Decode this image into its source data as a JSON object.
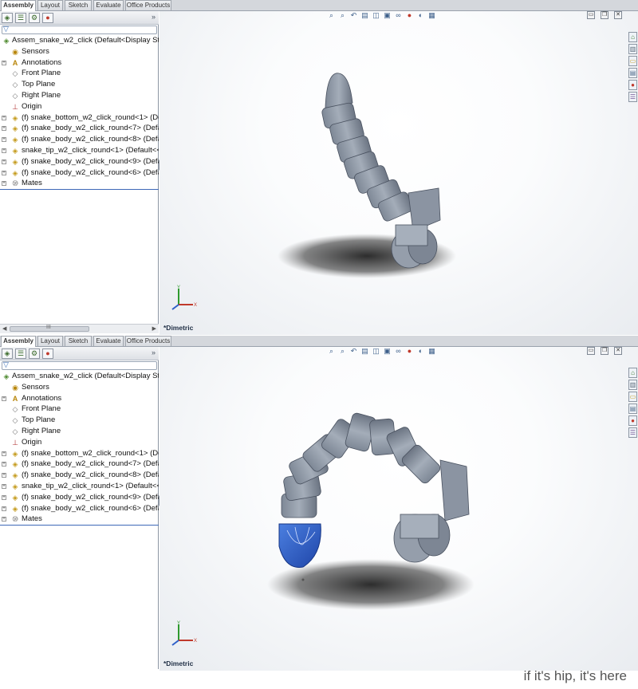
{
  "tabs": [
    "Assembly",
    "Layout",
    "Sketch",
    "Evaluate",
    "Office Products"
  ],
  "tree": {
    "root": "Assem_snake_w2_click  (Default<Display Sta",
    "items": [
      {
        "label": "Sensors",
        "icon": "sensor-icon",
        "expandable": false
      },
      {
        "label": "Annotations",
        "icon": "annotations-icon",
        "expandable": true
      },
      {
        "label": "Front Plane",
        "icon": "plane-icon",
        "expandable": false
      },
      {
        "label": "Top Plane",
        "icon": "plane-icon",
        "expandable": false
      },
      {
        "label": "Right Plane",
        "icon": "plane-icon",
        "expandable": false
      },
      {
        "label": "Origin",
        "icon": "origin-icon",
        "expandable": false
      },
      {
        "label": "(f) snake_bottom_w2_click_round<1> (De",
        "icon": "part-icon",
        "expandable": true
      },
      {
        "label": "(f) snake_body_w2_click_round<7> (Defa",
        "icon": "part-icon",
        "expandable": true
      },
      {
        "label": "(f) snake_body_w2_click_round<8> (Defa",
        "icon": "part-icon",
        "expandable": true
      },
      {
        "label": "snake_tip_w2_click_round<1> (Default<<",
        "icon": "part-icon",
        "expandable": true
      },
      {
        "label": "(f) snake_body_w2_click_round<9> (Defa",
        "icon": "part-icon",
        "expandable": true
      },
      {
        "label": "(f) snake_body_w2_click_round<6> (Defa",
        "icon": "part-icon",
        "expandable": true
      },
      {
        "label": "Mates",
        "icon": "mates-icon",
        "expandable": true
      }
    ]
  },
  "view_orientation": "*Dimetric",
  "scroll_label": "III",
  "watermark": "if it's hip, it's here",
  "colors": {
    "part_gray": "#8d97a5",
    "selected_part": "#2f5fc9",
    "tree_divider": "#3e68b8"
  }
}
